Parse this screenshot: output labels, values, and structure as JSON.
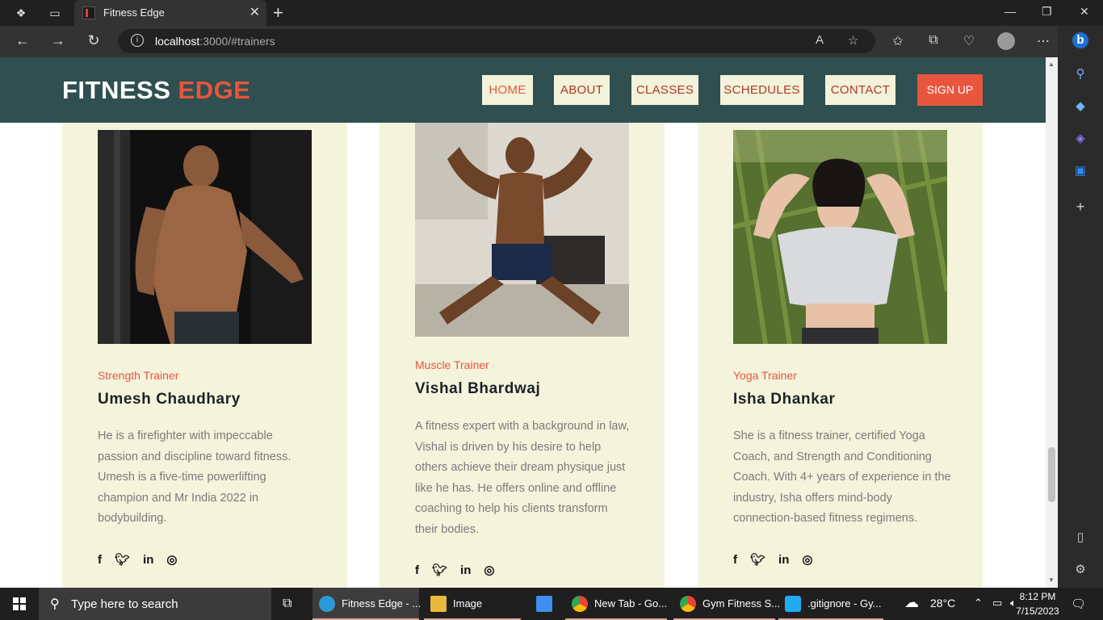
{
  "browser": {
    "tab_title": "Fitness Edge",
    "url_host": "localhost",
    "url_rest": ":3000/#trainers"
  },
  "site": {
    "logo_part1": "FITNESS",
    "logo_part2": "EDGE",
    "nav": [
      "HOME",
      "ABOUT",
      "CLASSES",
      "SCHEDULES",
      "CONTACT"
    ],
    "signup": "SIGN UP"
  },
  "trainers": [
    {
      "role": "Strength Trainer",
      "name": "Umesh Chaudhary",
      "bio": "He is a firefighter with impeccable passion and discipline toward fitness. Umesh is a five-time powerlifting champion and Mr India 2022 in bodybuilding."
    },
    {
      "role": "Muscle Trainer",
      "name": "Vishal Bhardwaj",
      "bio": "A fitness expert with a background in law, Vishal is driven by his desire to help others achieve their dream physique just like he has. He offers online and offline coaching to help his clients transform their bodies."
    },
    {
      "role": "Yoga Trainer",
      "name": "Isha Dhankar",
      "bio": "She is a fitness trainer, certified Yoga Coach, and Strength and Conditioning Coach. With 4+ years of experience in the industry, Isha offers mind-body connection-based fitness regimens."
    }
  ],
  "social_icons": [
    "facebook-icon",
    "twitter-icon",
    "linkedin-icon",
    "instagram-icon"
  ],
  "taskbar": {
    "search_placeholder": "Type here to search",
    "apps": [
      "Fitness Edge - ...",
      "Image",
      "New Tab - Go...",
      "Gym Fitness S...",
      ".gitignore - Gy..."
    ],
    "weather": "28°C",
    "time": "8:12 PM",
    "date": "7/15/2023"
  },
  "colors": {
    "header_bg": "#2f4f50",
    "accent": "#e8563d",
    "card_bg": "#f4f3dc"
  }
}
